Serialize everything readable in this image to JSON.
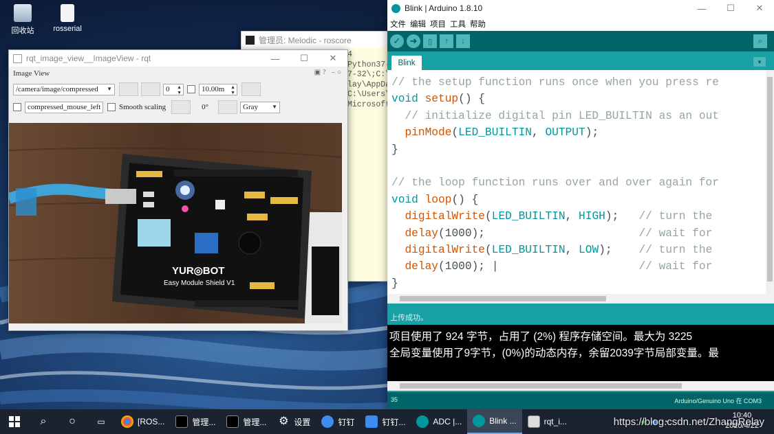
{
  "desktop": {
    "icons": [
      {
        "label": "回收站"
      },
      {
        "label": "rosserial"
      }
    ]
  },
  "console": {
    "title": "管理员: Melodic - roscore",
    "lines": [
      "4",
      "",
      "",
      "Python37-",
      "7-32\\;C:\\",
      "lay\\AppDa",
      "C:\\Users\\",
      "Microsoft"
    ]
  },
  "rqt": {
    "title": "rqt_image_view__ImageView - rqt",
    "panel_title": "Image View",
    "topic": "/camera/image/compressed",
    "spin_value": "0",
    "max_value": "10.00m",
    "mouse_topic": "compressed_mouse_left",
    "smooth_label": "Smooth scaling",
    "rotation": "0°",
    "color_scheme": "Gray",
    "board_brand": "YUR◎BOT",
    "board_name": "Easy Module Shield V1"
  },
  "arduino": {
    "title": "Blink | Arduino 1.8.10",
    "menu": [
      "文件",
      "编辑",
      "项目",
      "工具",
      "帮助"
    ],
    "tab": "Blink",
    "status": "上传成功。",
    "output_lines": [
      "项目使用了 924 字节，占用了 (2%) 程序存储空间。最大为 3225",
      "全局变量使用了9字节，(0%)的动态内存，余留2039字节局部变量。最"
    ],
    "line_number": "35",
    "board": "Arduino/Genuino Uno 在 COM3"
  },
  "taskbar": {
    "items": [
      {
        "label": "[ROS...",
        "icon": "chrome-icon"
      },
      {
        "label": "管理...",
        "icon": "terminal-icon"
      },
      {
        "label": "管理...",
        "icon": "terminal-icon"
      },
      {
        "label": "设置",
        "icon": "gear-icon"
      },
      {
        "label": "钉钉",
        "icon": "dingtalk-icon"
      },
      {
        "label": "钉钉...",
        "icon": "dingtalk-icon"
      },
      {
        "label": "ADC |...",
        "icon": "arduino-icon"
      },
      {
        "label": "Blink ...",
        "icon": "arduino-icon"
      },
      {
        "label": "rqt_i...",
        "icon": "rqt-icon"
      }
    ],
    "time": "10:40",
    "date": "2020/4/22"
  },
  "watermark": "https://blog.csdn.net/ZhangRelay"
}
